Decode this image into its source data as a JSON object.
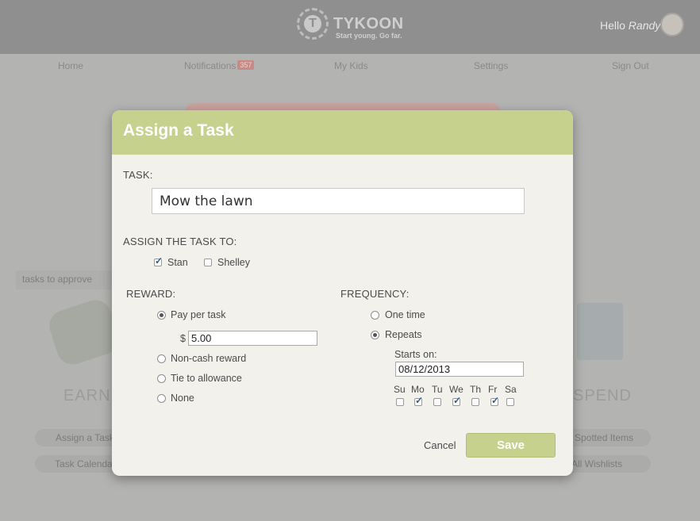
{
  "header": {
    "brand_name": "TYKOON",
    "tagline": "Start young. Go far.",
    "logo_letter": "T",
    "greeting_prefix": "Hello",
    "user_name": "Randy"
  },
  "nav": {
    "home": "Home",
    "notifications": "Notifications",
    "notifications_count": "357",
    "my_kids": "My Kids",
    "settings": "Settings",
    "sign_out": "Sign Out"
  },
  "background": {
    "tasks_to_approve": "tasks to approve",
    "earn_label": "EARN",
    "spend_label": "SPEND",
    "assign_task_link": "Assign a Task",
    "task_calendar_link": "Task Calendar",
    "spotted_items_link": "Spotted Items",
    "all_wishlists_link": "All Wishlists"
  },
  "modal": {
    "title": "Assign a Task",
    "task_label": "TASK:",
    "task_value": "Mow the lawn",
    "assign_label": "ASSIGN THE TASK TO:",
    "kids": [
      {
        "name": "Stan",
        "checked": true
      },
      {
        "name": "Shelley",
        "checked": false
      }
    ],
    "reward_label": "REWARD:",
    "reward_options": {
      "pay_per_task": "Pay per task",
      "non_cash": "Non-cash reward",
      "tie_allowance": "Tie to allowance",
      "none": "None"
    },
    "reward_selected": "Pay per task",
    "currency_symbol": "$",
    "amount": "5.00",
    "frequency_label": "FREQUENCY:",
    "frequency_options": {
      "one_time": "One time",
      "repeats": "Repeats"
    },
    "frequency_selected": "Repeats",
    "starts_on_label": "Starts on:",
    "starts_on_value": "08/12/2013",
    "days": [
      {
        "label": "Su",
        "checked": false
      },
      {
        "label": "Mo",
        "checked": true
      },
      {
        "label": "Tu",
        "checked": false
      },
      {
        "label": "We",
        "checked": true
      },
      {
        "label": "Th",
        "checked": false
      },
      {
        "label": "Fr",
        "checked": true
      },
      {
        "label": "Sa",
        "checked": false
      }
    ],
    "cancel_label": "Cancel",
    "save_label": "Save"
  },
  "colors": {
    "accent": "#c7d18e",
    "modal_bg": "#f2f1ec"
  }
}
